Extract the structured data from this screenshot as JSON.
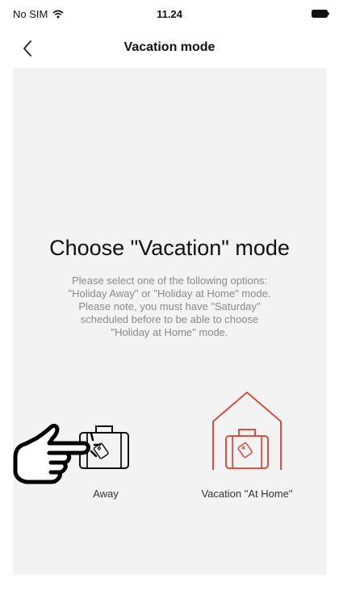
{
  "status_bar": {
    "carrier": "No SIM",
    "time": "11.24",
    "wifi_icon": "wifi-icon",
    "battery_icon": "battery-icon"
  },
  "nav": {
    "back_icon": "chevron-left-icon",
    "title": "Vacation mode"
  },
  "main": {
    "heading": "Choose \"Vacation\" mode",
    "description": "Please select one of the following options: \"Holiday Away\" or \"Holiday at Home\" mode. Please note, you must have \"Saturday\" scheduled before to be able to choose \"Holiday at Home\" mode.",
    "options": [
      {
        "label": "Away",
        "icon": "suitcase-icon",
        "color": "#111111"
      },
      {
        "label": "Vacation \"At Home\"",
        "icon": "house-suitcase-icon",
        "color": "#e03a2a"
      }
    ]
  },
  "overlay": {
    "pointer_icon": "pointing-hand-icon"
  },
  "colors": {
    "accent": "#e03a2a",
    "background": "#f3f3f3",
    "text_muted": "#8a8a8a"
  }
}
